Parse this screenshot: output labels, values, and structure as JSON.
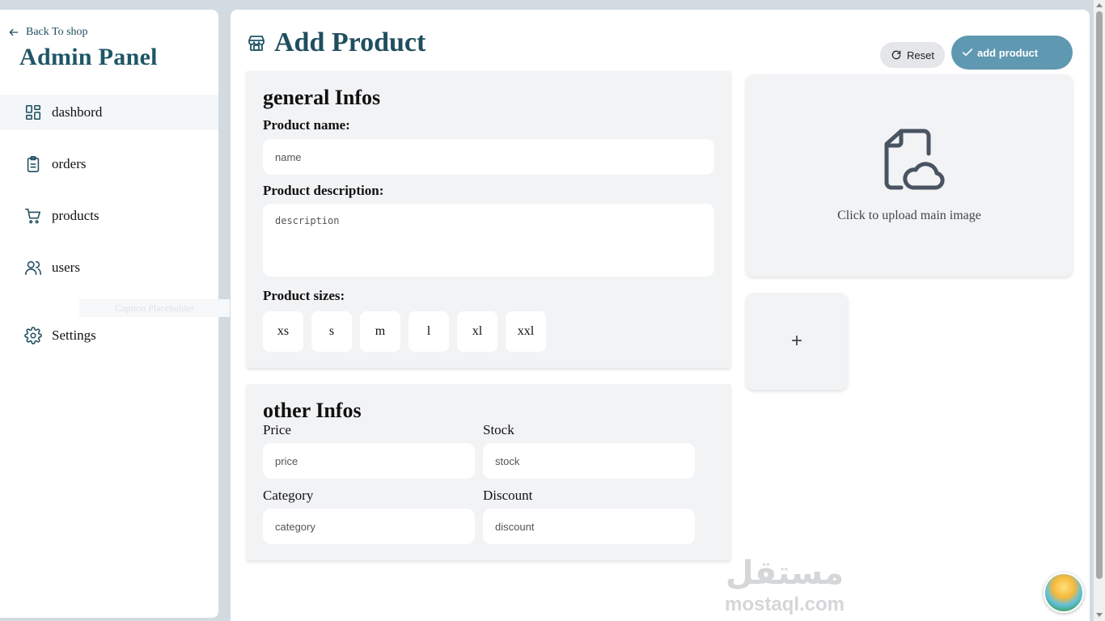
{
  "sidebar": {
    "back_label": "Back To shop",
    "brand": "Admin Panel",
    "items": [
      {
        "label": "dashbord",
        "icon": "dashboard-icon"
      },
      {
        "label": "orders",
        "icon": "clipboard-icon"
      },
      {
        "label": "products",
        "icon": "cart-icon"
      },
      {
        "label": "users",
        "icon": "users-icon"
      },
      {
        "label": "Settings",
        "icon": "gear-icon"
      }
    ],
    "faded_label": "Caption Placeholder"
  },
  "header": {
    "title": "Add Product",
    "reset_label": "Reset",
    "add_label": "add product"
  },
  "general": {
    "title": "general Infos",
    "name_label": "Product name:",
    "name_placeholder": "name",
    "description_label": "Product description:",
    "description_placeholder": "description",
    "sizes_label": "Product sizes:",
    "sizes": [
      "xs",
      "s",
      "m",
      "l",
      "xl",
      "xxl"
    ]
  },
  "other": {
    "title": "other Infos",
    "price_label": "Price",
    "price_placeholder": "price",
    "stock_label": "Stock",
    "stock_placeholder": "stock",
    "category_label": "Category",
    "category_placeholder": "category",
    "discount_label": "Discount",
    "discount_placeholder": "discount"
  },
  "upload": {
    "main_text": "Click to upload main image",
    "add_more_symbol": "+"
  },
  "watermark": {
    "arabic": "مستقل",
    "latin": "mostaql.com"
  },
  "colors": {
    "brand": "#1f5668",
    "accent_button": "#5e98b1",
    "card_bg": "#f2f3f5",
    "page_bg": "#d3dbe2"
  }
}
